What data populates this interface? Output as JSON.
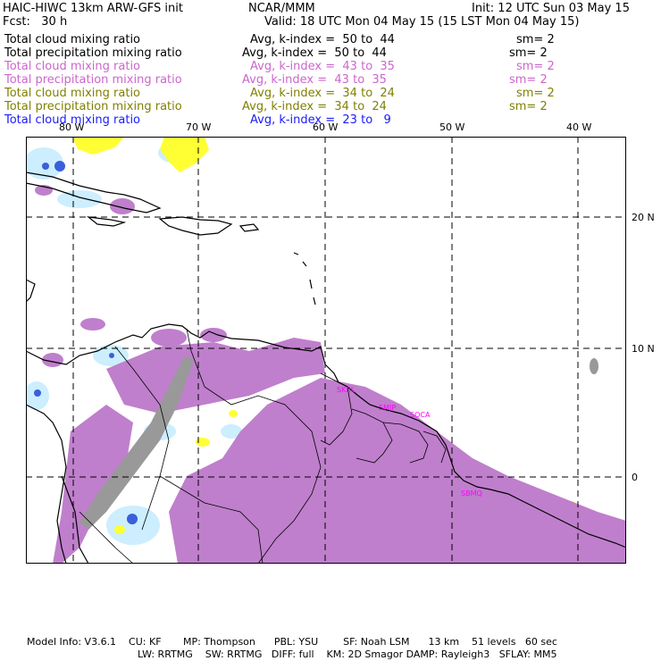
{
  "header": {
    "left_title": "HAIC-HIWC 13km ARW-GFS init",
    "center_title": "NCAR/MMM",
    "init": "Init: 12 UTC Sun 03 May 15",
    "fcst": "Fcst:   30 h",
    "valid": "Valid: 18 UTC Mon 04 May 15 (15 LST Mon 04 May 15)"
  },
  "legend": [
    {
      "field": "Total cloud mixing ratio",
      "avg": "Avg, k-index =  50 to  44",
      "sm": "sm= 2",
      "color": "#000000"
    },
    {
      "field": "Total precipitation mixing ratio",
      "avg": "Avg, k-index =  50 to  44",
      "sm": "sm= 2",
      "color": "#000000"
    },
    {
      "field": "Total cloud mixing ratio",
      "avg": "Avg, k-index =  43 to  35",
      "sm": "sm= 2",
      "color": "#cc66cc"
    },
    {
      "field": "Total precipitation mixing ratio",
      "avg": "Avg, k-index =  43 to  35",
      "sm": "sm= 2",
      "color": "#cc66cc"
    },
    {
      "field": "Total cloud mixing ratio",
      "avg": "Avg, k-index =  34 to  24",
      "sm": "sm= 2",
      "color": "#808000"
    },
    {
      "field": "Total precipitation mixing ratio",
      "avg": "Avg, k-index =  34 to  24",
      "sm": "sm= 2",
      "color": "#808000"
    },
    {
      "field": "Total cloud mixing ratio",
      "avg": "Avg, k-index =  23 to   9",
      "sm": "",
      "color": "#1a1aff"
    }
  ],
  "map": {
    "lon_labels": [
      "80 W",
      "70 W",
      "60 W",
      "50 W",
      "40 W"
    ],
    "lat_labels": [
      "20 N",
      "10 N",
      "0"
    ],
    "place_labels": [
      "SKBL",
      "SMJP",
      "SOCA",
      "SBMQ"
    ],
    "fill_colors": {
      "purple": "#bf7fcc",
      "yellow": "#ffff33",
      "lightblue": "#cceeff",
      "blue": "#3a5fd9",
      "gray": "#999999"
    }
  },
  "footer": {
    "line1": "Model Info: V3.6.1    CU: KF       MP: Thompson      PBL: YSU        SF: Noah LSM      13 km    51 levels   60 sec",
    "line2": "LW: RRTMG    SW: RRTMG   DIFF: full    KM: 2D Smagor DAMP: Rayleigh3   SFLAY: MM5"
  }
}
